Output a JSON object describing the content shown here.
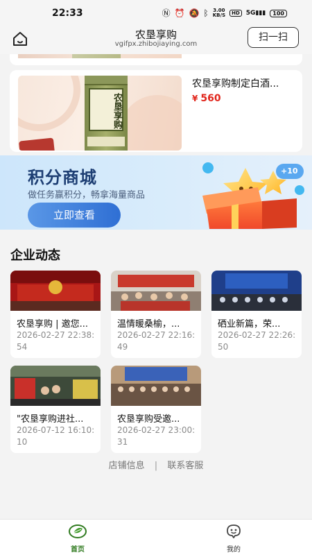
{
  "status_bar": {
    "time": "22:33",
    "net_speed_value": "3.00",
    "net_speed_unit": "KB/S",
    "hd": "HD",
    "signal": "5G",
    "battery": "100"
  },
  "header": {
    "title": "农垦享购",
    "url": "vgifpx.zhibojiaying.com",
    "scan_label": "扫一扫"
  },
  "product": {
    "name": "农垦享购制定白酒...",
    "currency": "¥",
    "price": "560",
    "bottle_text": "农垦享购"
  },
  "points_banner": {
    "title": "积分商城",
    "subtitle": "做任务赢积分，畅拿海量商品",
    "button": "立即查看",
    "badge": "+10"
  },
  "news_section": {
    "title": "企业动态",
    "items": [
      {
        "title": "农垦享购 | 邀您...",
        "time": "2026-02-27 22:38:54"
      },
      {
        "title": "温情暖桑榆，...",
        "time": "2026-02-27 22:16:49"
      },
      {
        "title": "硒业新篇，荣...",
        "time": "2026-02-27 22:26:50"
      },
      {
        "title": "\"农垦享购进社...",
        "time": "2026-07-12 16:10:10"
      },
      {
        "title": "农垦享购受邀...",
        "time": "2026-02-27 23:00:31"
      }
    ]
  },
  "footer_links": {
    "shop_info": "店铺信息",
    "separator": "|",
    "contact": "联系客服"
  },
  "tab_bar": {
    "home": "首页",
    "mine": "我的"
  },
  "colors": {
    "accent_green": "#2f7a1f",
    "price_red": "#e1251b",
    "banner_blue": "#2f6fd4"
  }
}
